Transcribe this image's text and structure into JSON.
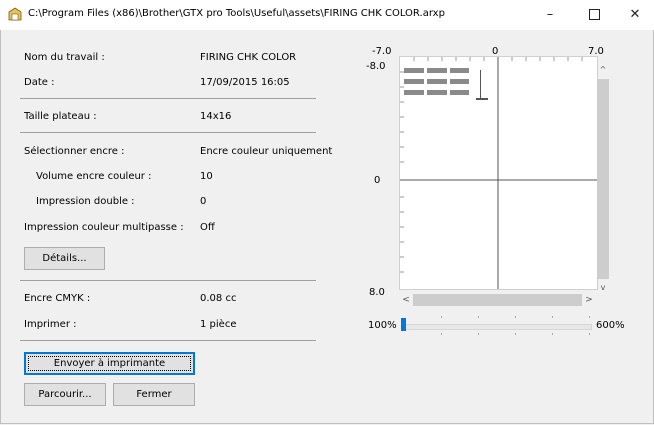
{
  "window": {
    "title": "C:\\Program Files (x86)\\Brother\\GTX pro Tools\\Useful\\assets\\FIRING CHK COLOR.arxp",
    "minimize": "–",
    "close": "✕"
  },
  "info": {
    "job_name_label": "Nom du travail :",
    "job_name_value": "FIRING CHK COLOR",
    "date_label": "Date :",
    "date_value": "17/09/2015 16:05",
    "platen_label": "Taille plateau :",
    "platen_value": "14x16",
    "ink_select_label": "Sélectionner encre :",
    "ink_select_value": "Encre couleur uniquement",
    "color_volume_label": "Volume encre couleur :",
    "color_volume_value": "10",
    "double_print_label": "Impression double :",
    "double_print_value": "0",
    "multipass_label": "Impression couleur multipasse :",
    "multipass_value": "Off",
    "details_button": "Détails...",
    "cmyk_label": "Encre CMYK :",
    "cmyk_value": "0.08 cc",
    "print_label": "Imprimer :",
    "print_value": "1 pièce"
  },
  "actions": {
    "send_button": "Envoyer à imprimante",
    "browse_button": "Parcourir...",
    "close_button": "Fermer"
  },
  "preview": {
    "x_min_label": "-7.0",
    "x_mid_label": "0",
    "x_max_label": "7.0",
    "y_top_label": "-8.0",
    "y_mid_label": "0",
    "y_bottom_label": "8.0"
  },
  "zoom": {
    "min_label": "100%",
    "max_label": "600%",
    "level_fraction": 0
  },
  "colors": {
    "accent": "#0078d7",
    "scroll_thumb": "#cdcdcd"
  }
}
